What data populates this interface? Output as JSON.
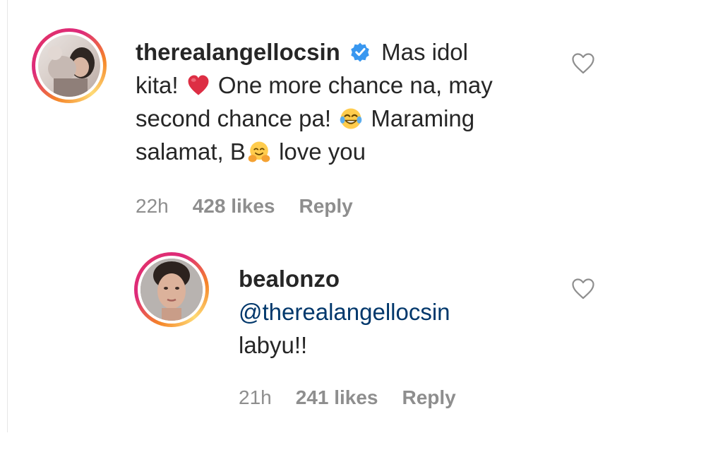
{
  "comments": [
    {
      "username": "therealangellocsin",
      "verified": true,
      "text_part1": "Mas idol",
      "text_part2": "kita!",
      "text_part3": "One more chance na, may",
      "text_part4": "second chance pa!",
      "text_part5": "Maraming",
      "text_part6": "salamat, B",
      "text_part7": "love you",
      "time": "22h",
      "likes": "428 likes",
      "reply_label": "Reply"
    },
    {
      "username": "bealonzo",
      "mention": "@therealangellocsin",
      "text": "labyu!!",
      "time": "21h",
      "likes": "241 likes",
      "reply_label": "Reply"
    }
  ],
  "icons": {
    "verified": "verified-badge-icon",
    "like": "heart-outline-icon",
    "emoji_heart": "red-heart-emoji",
    "emoji_laugh": "tears-of-joy-emoji",
    "emoji_hug": "hugging-face-emoji"
  },
  "colors": {
    "text": "#262626",
    "meta": "#8e8e8e",
    "mention": "#00376b",
    "verified": "#3897f0"
  }
}
